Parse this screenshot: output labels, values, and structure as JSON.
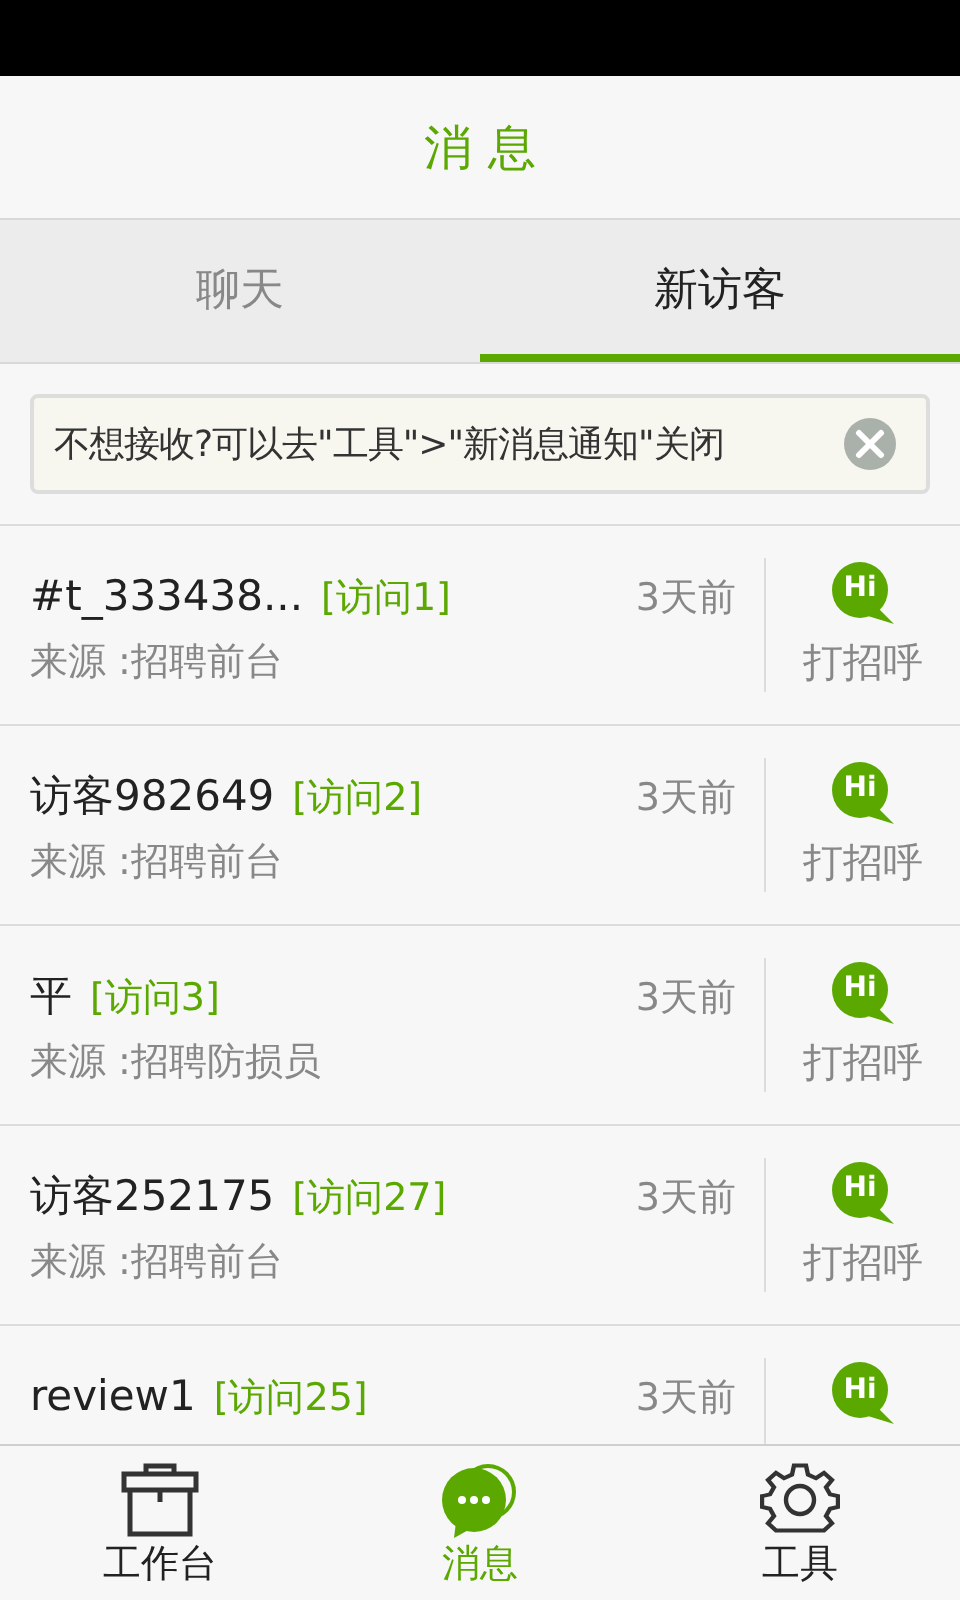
{
  "header": {
    "title": "消 息"
  },
  "tabs": [
    {
      "label": "聊天",
      "selected": false
    },
    {
      "label": "新访客",
      "selected": true
    }
  ],
  "notice": {
    "text": "不想接收?可以去\"工具\">\"新消息通知\"关闭"
  },
  "visitors": [
    {
      "name": "#t_333438...",
      "visits": "[访问1]",
      "time": "3天前",
      "source": "来源 :招聘前台",
      "hi": "Hi",
      "greet": "打招呼"
    },
    {
      "name": "访客982649",
      "visits": "[访问2]",
      "time": "3天前",
      "source": "来源 :招聘前台",
      "hi": "Hi",
      "greet": "打招呼"
    },
    {
      "name": "平",
      "visits": "[访问3]",
      "time": "3天前",
      "source": "来源 :招聘防损员",
      "hi": "Hi",
      "greet": "打招呼"
    },
    {
      "name": "访客252175",
      "visits": "[访问27]",
      "time": "3天前",
      "source": "来源 :招聘前台",
      "hi": "Hi",
      "greet": "打招呼"
    },
    {
      "name": "review1",
      "visits": "[访问25]",
      "time": "3天前",
      "hi": "Hi"
    }
  ],
  "bottom_nav": [
    {
      "kind": "workbench",
      "label": "工作台",
      "selected": false
    },
    {
      "kind": "messages",
      "label": "消息",
      "selected": true
    },
    {
      "kind": "tools",
      "label": "工具",
      "selected": false
    }
  ]
}
